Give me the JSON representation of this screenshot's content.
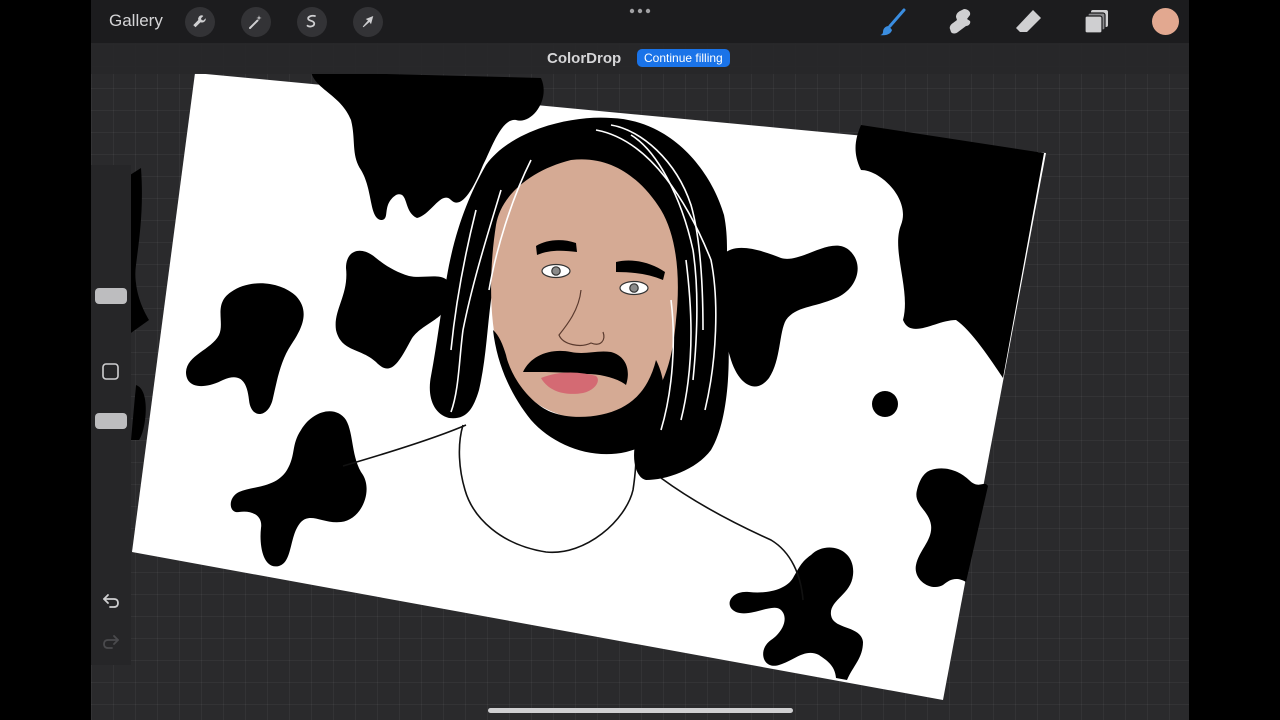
{
  "toolbar": {
    "gallery_label": "Gallery",
    "left_tools": [
      {
        "name": "wrench-icon"
      },
      {
        "name": "magic-wand-icon"
      },
      {
        "name": "selection-icon"
      },
      {
        "name": "transform-arrow-icon"
      }
    ],
    "right_tools": [
      {
        "name": "brush-icon",
        "active": true
      },
      {
        "name": "smudge-icon",
        "active": false
      },
      {
        "name": "eraser-icon",
        "active": false
      },
      {
        "name": "layers-icon",
        "active": false
      }
    ],
    "current_color": "#e2a890",
    "active_tool_color": "#3a8de0"
  },
  "colordrop": {
    "title": "ColorDrop",
    "continue_label": "Continue filling",
    "continue_color": "#1a73e8"
  },
  "sidebar": {
    "controls": [
      "brush-size-slider",
      "modify-button",
      "opacity-slider",
      "undo-icon",
      "redo-icon"
    ]
  },
  "canvas": {
    "background": "#ffffff",
    "ink": "#000000",
    "skin_color": "#d5aa94",
    "lip_color": "#d46a73",
    "subject": "portrait"
  }
}
